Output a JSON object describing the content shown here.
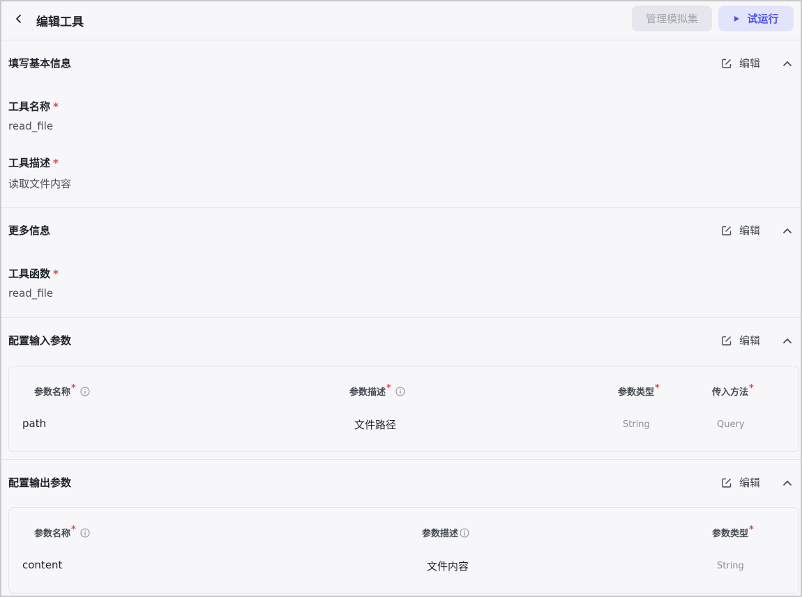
{
  "header": {
    "title": "编辑工具",
    "manage_label": "管理模拟集",
    "run_label": "试运行"
  },
  "common": {
    "edit_label": "编辑",
    "required_mark": "*"
  },
  "basic_info": {
    "title": "填写基本信息",
    "name_label": "工具名称",
    "name_value": "read_file",
    "desc_label": "工具描述",
    "desc_value": "读取文件内容"
  },
  "more_info": {
    "title": "更多信息",
    "func_label": "工具函数",
    "func_value": "read_file"
  },
  "input_params": {
    "title": "配置输入参数",
    "columns": [
      "参数名称",
      "参数描述",
      "参数类型",
      "传入方法"
    ],
    "rows": [
      {
        "name": "path",
        "desc": "文件路径",
        "type": "String",
        "method": "Query"
      }
    ]
  },
  "output_params": {
    "title": "配置输出参数",
    "columns": [
      "参数名称",
      "参数描述",
      "参数类型"
    ],
    "rows": [
      {
        "name": "content",
        "desc": "文件内容",
        "type": "String"
      }
    ]
  },
  "colors": {
    "accent": "#4d53e8",
    "required": "#e5484d",
    "background": "#f7f7f9"
  }
}
